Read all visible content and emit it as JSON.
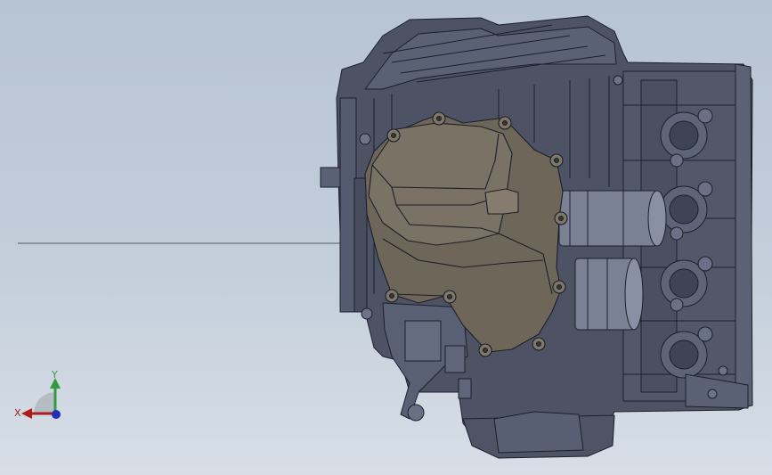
{
  "viewport": {
    "background_top": "#b7c4d3",
    "background_bottom": "#d7dee6"
  },
  "model": {
    "body_color": "#4d5365",
    "edge_color": "#1c1f2a",
    "cover_color": "#6e6658",
    "piston_color": "#7b8194"
  },
  "triad": {
    "x_label": "X",
    "y_label": "Y",
    "x_color": "#b01b1b",
    "y_color": "#2e9e3a",
    "z_color": "#1f2fb8",
    "icon": "coordinate-axes-icon"
  }
}
